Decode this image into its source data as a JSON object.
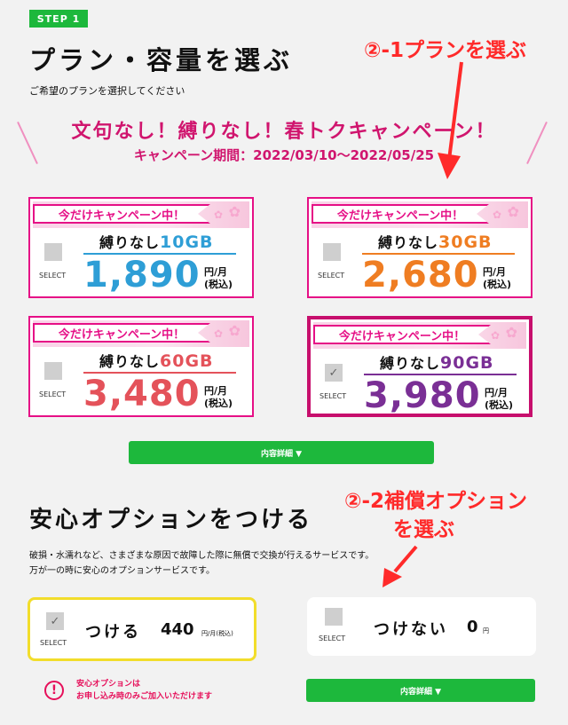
{
  "step": {
    "badge": "STEP 1",
    "title": "プラン・容量を選ぶ",
    "subtitle": "ご希望のプランを選択してください"
  },
  "annotations": {
    "plan": "②-1プランを選ぶ",
    "option_line1": "②-2補償オプション",
    "option_line2": "を選ぶ"
  },
  "campaign": {
    "title": "文句なし！縛りなし！春トクキャンペーン！",
    "period": "キャンペーン期間：2022/03/10〜2022/05/25"
  },
  "plans": [
    {
      "banner": "今だけキャンペーン中！",
      "checkbox": "",
      "select": "SELECT",
      "name": "縛りなし",
      "gb": "10GB",
      "price": "1,890",
      "unit1": "円/月",
      "unit2": "(税込)",
      "color": "#2e9ed6",
      "selected": false
    },
    {
      "banner": "今だけキャンペーン中！",
      "checkbox": "",
      "select": "SELECT",
      "name": "縛りなし",
      "gb": "30GB",
      "price": "2,680",
      "unit1": "円/月",
      "unit2": "(税込)",
      "color": "#ef7d22",
      "selected": false
    },
    {
      "banner": "今だけキャンペーン中！",
      "checkbox": "",
      "select": "SELECT",
      "name": "縛りなし",
      "gb": "60GB",
      "price": "3,480",
      "unit1": "円/月",
      "unit2": "(税込)",
      "color": "#e4525a",
      "selected": false
    },
    {
      "banner": "今だけキャンペーン中！",
      "checkbox": "✓",
      "select": "SELECT",
      "name": "縛りなし",
      "gb": "90GB",
      "price": "3,980",
      "unit1": "円/月",
      "unit2": "(税込)",
      "color": "#7a2f95",
      "selected": true
    }
  ],
  "detail_button": "内容詳細 ▼",
  "option_section": {
    "title": "安心オプションをつける",
    "desc_line1": "破損・水濡れなど、さまざまな原因で故障した際に無償で交換が行えるサービスです。",
    "desc_line2": "万が一の時に安心のオプションサービスです。"
  },
  "options": [
    {
      "checkbox": "✓",
      "select": "SELECT",
      "label": "つける",
      "price": "440",
      "unit": "円/月(税込)",
      "selected": true
    },
    {
      "checkbox": "",
      "select": "SELECT",
      "label": "つけない",
      "price": "0",
      "unit": "円",
      "selected": false
    }
  ],
  "notice": {
    "icon": "!",
    "line1": "安心オプションは",
    "line2": "お申し込み時のみご加入いただけます"
  },
  "colors": {
    "accent_green": "#1db83c",
    "magenta": "#e60f86",
    "annotation_red": "#ff2a2a",
    "option_selected_border": "#f2dd2b"
  }
}
